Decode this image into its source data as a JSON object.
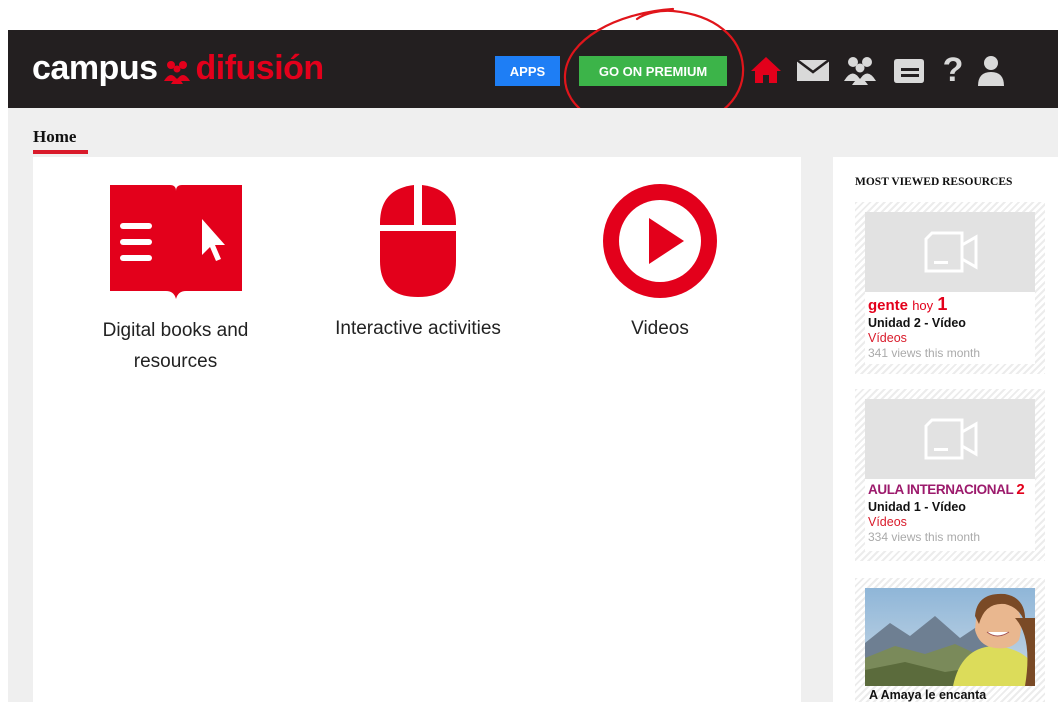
{
  "header": {
    "logo_left": "campus",
    "logo_right": "difusión",
    "apps_label": "APPS",
    "premium_label": "GO ON PREMIUM",
    "icons": [
      "home-icon",
      "mail-icon",
      "group-icon",
      "folder-icon",
      "help-icon",
      "user-icon"
    ],
    "help_glyph": "?"
  },
  "breadcrumb": {
    "home": "Home"
  },
  "tiles": [
    {
      "label": "Digital books and resources",
      "icon": "book-cursor-icon"
    },
    {
      "label": "Interactive activities",
      "icon": "mouse-icon"
    },
    {
      "label": "Videos",
      "icon": "play-icon"
    }
  ],
  "sidebar": {
    "title": "MOST VIEWED RESOURCES",
    "resources": [
      {
        "brand": "gente",
        "brand_suffix": "hoy",
        "brand_num": "1",
        "title": "Unidad 2 - Vídeo",
        "category": "Vídeos",
        "views": "341 views this month"
      },
      {
        "brand": "AULA INTERNACIONAL",
        "brand_num": "2",
        "title": "Unidad 1 - Vídeo",
        "category": "Vídeos",
        "views": "334 views this month"
      }
    ],
    "photo_caption": "A Amaya le encanta"
  },
  "colors": {
    "header_bg": "#231f20",
    "brand_red": "#e3001b",
    "apps_blue": "#1e7ef5",
    "premium_green": "#3cb449",
    "aula_purple": "#9c1a6c",
    "annotation_red": "#e0151b"
  }
}
